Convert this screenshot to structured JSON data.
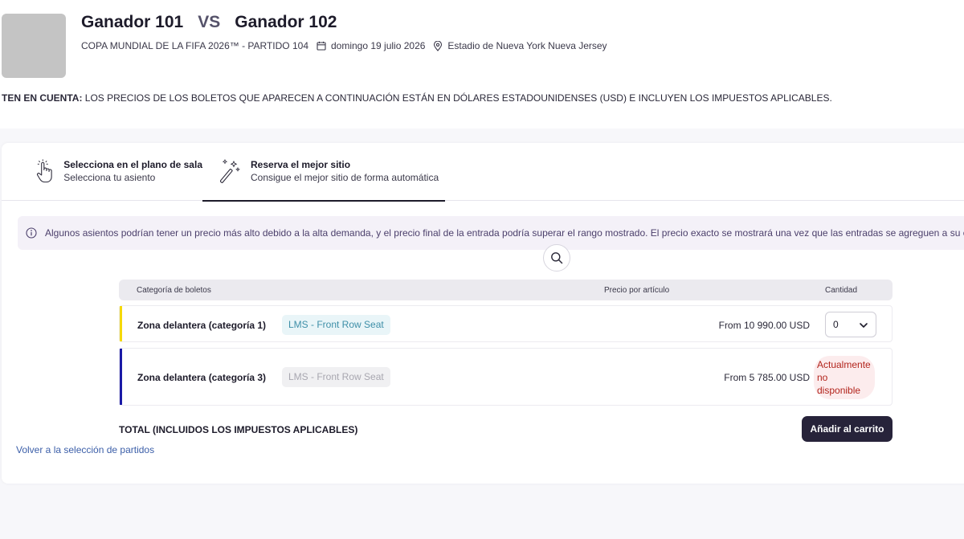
{
  "header": {
    "team_home": "Ganador 101",
    "vs": "VS",
    "team_away": "Ganador 102",
    "competition": "COPA MUNDIAL DE LA FIFA 2026™ - PARTIDO 104",
    "date": "domingo 19 julio 2026",
    "venue": "Estadio de Nueva York Nueva Jersey"
  },
  "notice": {
    "label": "TEN EN CUENTA:",
    "text": " LOS PRECIOS DE LOS BOLETOS QUE APARECEN A CONTINUACIÓN ESTÁN EN DÓLARES ESTADOUNIDENSES (USD) E INCLUYEN LOS IMPUESTOS APLICABLES."
  },
  "tabs": [
    {
      "title": "Selecciona en el plano de sala",
      "subtitle": "Selecciona tu asiento",
      "active": false
    },
    {
      "title": "Reserva el mejor sitio",
      "subtitle": "Consigue el mejor sitio de forma automática",
      "active": true
    }
  ],
  "info_banner": "Algunos asientos podrían tener un precio más alto debido a la alta demanda, y el precio final de la entrada podría superar el rango mostrado. El precio exacto se mostrará una vez que las entradas se agreguen a su carrito.",
  "table": {
    "headers": {
      "category": "Categoría de boletos",
      "price": "Precio por artículo",
      "quantity": "Cantidad"
    },
    "rows": [
      {
        "name": "Zona delantera (categoría 1)",
        "tag": "LMS - Front Row Seat",
        "price": "From 10 990.00 USD",
        "quantity": "0",
        "accent": "#f5d90a"
      },
      {
        "name": "Zona delantera (categoría 3)",
        "tag": "LMS - Front Row Seat",
        "price": "From 5 785.00 USD",
        "status": "Actualmente no disponible",
        "accent": "#1a1aa6"
      }
    ]
  },
  "total_label": "TOTAL (INCLUIDOS LOS IMPUESTOS APLICABLES)",
  "add_to_cart": "Añadir al carrito",
  "back_link": "Volver a la selección de partidos"
}
